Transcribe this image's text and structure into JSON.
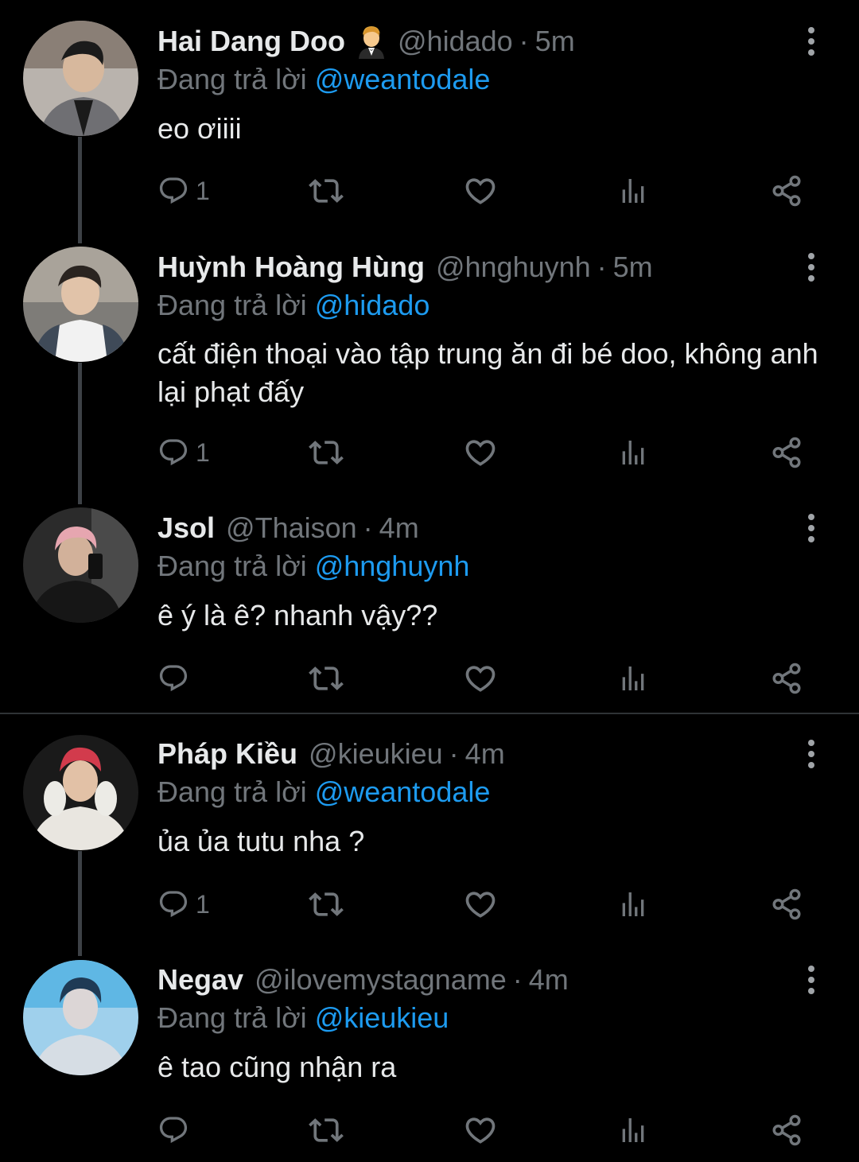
{
  "colors": {
    "background": "#000000",
    "text": "#e7e9ea",
    "muted": "#71767b",
    "link": "#1d9bf0",
    "thread_line": "#3d4146",
    "divider": "#2f3336"
  },
  "icons": {
    "reply": "speech-bubble-icon",
    "retweet": "retweet-arrows-icon",
    "like": "heart-icon",
    "views": "bar-chart-icon",
    "share": "share-nodes-icon",
    "more": "vertical-ellipsis-icon",
    "emoji": "person-in-tuxedo-emoji"
  },
  "separator": "·",
  "tweets": [
    {
      "name": "Hai Dang Doo",
      "handle": "@hidado",
      "time": "5m",
      "reply_label": "Đang trả lời",
      "reply_to": "@weantodale",
      "text": "eo ơiiii",
      "reply_count": "1"
    },
    {
      "name": "Huỳnh Hoàng Hùng",
      "handle": "@hnghuynh",
      "time": "5m",
      "reply_label": "Đang trả lời",
      "reply_to": "@hidado",
      "text": "cất điện thoại vào tập trung ăn đi bé doo, không anh lại phạt đấy",
      "reply_count": "1"
    },
    {
      "name": "Jsol",
      "handle": "@Thaison",
      "time": "4m",
      "reply_label": "Đang trả lời",
      "reply_to": "@hnghuynh",
      "text": "ê ý là ê? nhanh vậy??",
      "reply_count": ""
    },
    {
      "name": "Pháp Kiều",
      "handle": "@kieukieu",
      "time": "4m",
      "reply_label": "Đang trả lời",
      "reply_to": "@weantodale",
      "text": "ủa ủa tutu nha ?",
      "reply_count": "1"
    },
    {
      "name": "Negav",
      "handle": "@ilovemystagname",
      "time": "4m",
      "reply_label": "Đang trả lời",
      "reply_to": "@kieukieu",
      "text": "ê tao cũng nhận ra",
      "reply_count": ""
    }
  ]
}
